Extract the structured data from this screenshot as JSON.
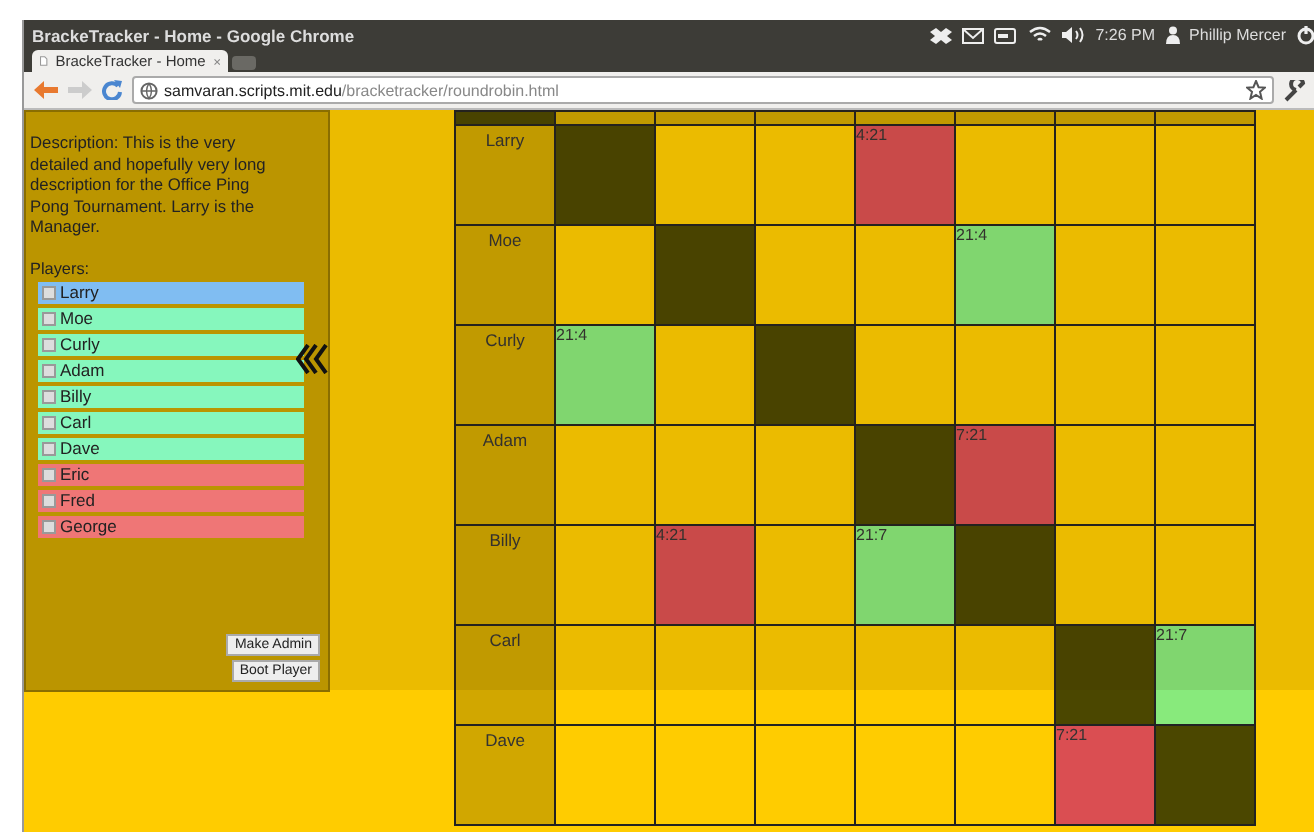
{
  "window": {
    "title": "BrackeTracker - Home - Google Chrome"
  },
  "tray": {
    "time": "7:26 PM",
    "user": "Phillip Mercer"
  },
  "tabs": [
    {
      "label": "BrackeTracker - Home",
      "selected": true
    }
  ],
  "address_bar": {
    "host": "samvaran.scripts.mit.edu",
    "path": "/bracketracker/roundrobin.html"
  },
  "sidebar": {
    "description": "Description: This is the very detailed and hopefully very long description for the Office Ping Pong Tournament. Larry is the Manager.",
    "players_label": "Players:",
    "players": [
      {
        "name": "Larry",
        "checked": false,
        "color": "#80bdf2"
      },
      {
        "name": "Moe",
        "checked": false,
        "color": "#86f7bd"
      },
      {
        "name": "Curly",
        "checked": false,
        "color": "#86f7bd"
      },
      {
        "name": "Adam",
        "checked": false,
        "color": "#86f7bd"
      },
      {
        "name": "Billy",
        "checked": false,
        "color": "#86f7bd"
      },
      {
        "name": "Carl",
        "checked": false,
        "color": "#86f7bd"
      },
      {
        "name": "Dave",
        "checked": false,
        "color": "#86f7bd"
      },
      {
        "name": "Eric",
        "checked": false,
        "color": "#ef7676"
      },
      {
        "name": "Fred",
        "checked": false,
        "color": "#ef7676"
      },
      {
        "name": "George",
        "checked": false,
        "color": "#ef7676"
      }
    ],
    "buttons": [
      "Make Admin",
      "Boot Player"
    ]
  },
  "grid": {
    "rows": [
      {
        "name": "Larry",
        "cells": [
          {
            "kind": "self"
          },
          {
            "kind": "empty"
          },
          {
            "kind": "empty"
          },
          {
            "kind": "loss",
            "score": "4:21"
          },
          {
            "kind": "empty"
          },
          {
            "kind": "empty"
          },
          {
            "kind": "empty"
          }
        ]
      },
      {
        "name": "Moe",
        "cells": [
          {
            "kind": "empty"
          },
          {
            "kind": "self"
          },
          {
            "kind": "empty"
          },
          {
            "kind": "empty"
          },
          {
            "kind": "win",
            "score": "21:4"
          },
          {
            "kind": "empty"
          },
          {
            "kind": "empty"
          }
        ]
      },
      {
        "name": "Curly",
        "cells": [
          {
            "kind": "win",
            "score": "21:4"
          },
          {
            "kind": "empty"
          },
          {
            "kind": "self"
          },
          {
            "kind": "empty"
          },
          {
            "kind": "empty"
          },
          {
            "kind": "empty"
          },
          {
            "kind": "empty"
          }
        ]
      },
      {
        "name": "Adam",
        "cells": [
          {
            "kind": "empty"
          },
          {
            "kind": "empty"
          },
          {
            "kind": "empty"
          },
          {
            "kind": "self"
          },
          {
            "kind": "loss",
            "score": "7:21"
          },
          {
            "kind": "empty"
          },
          {
            "kind": "empty"
          }
        ]
      },
      {
        "name": "Billy",
        "cells": [
          {
            "kind": "empty"
          },
          {
            "kind": "loss",
            "score": "4:21"
          },
          {
            "kind": "empty"
          },
          {
            "kind": "win",
            "score": "21:7"
          },
          {
            "kind": "self"
          },
          {
            "kind": "empty"
          },
          {
            "kind": "empty"
          }
        ]
      },
      {
        "name": "Carl",
        "cells": [
          {
            "kind": "empty"
          },
          {
            "kind": "empty"
          },
          {
            "kind": "empty"
          },
          {
            "kind": "empty"
          },
          {
            "kind": "empty"
          },
          {
            "kind": "self"
          },
          {
            "kind": "win",
            "score": "21:7"
          }
        ]
      },
      {
        "name": "Dave",
        "cells": [
          {
            "kind": "empty"
          },
          {
            "kind": "empty"
          },
          {
            "kind": "empty"
          },
          {
            "kind": "empty"
          },
          {
            "kind": "empty"
          },
          {
            "kind": "loss",
            "score": "7:21"
          },
          {
            "kind": "self"
          }
        ]
      }
    ]
  }
}
